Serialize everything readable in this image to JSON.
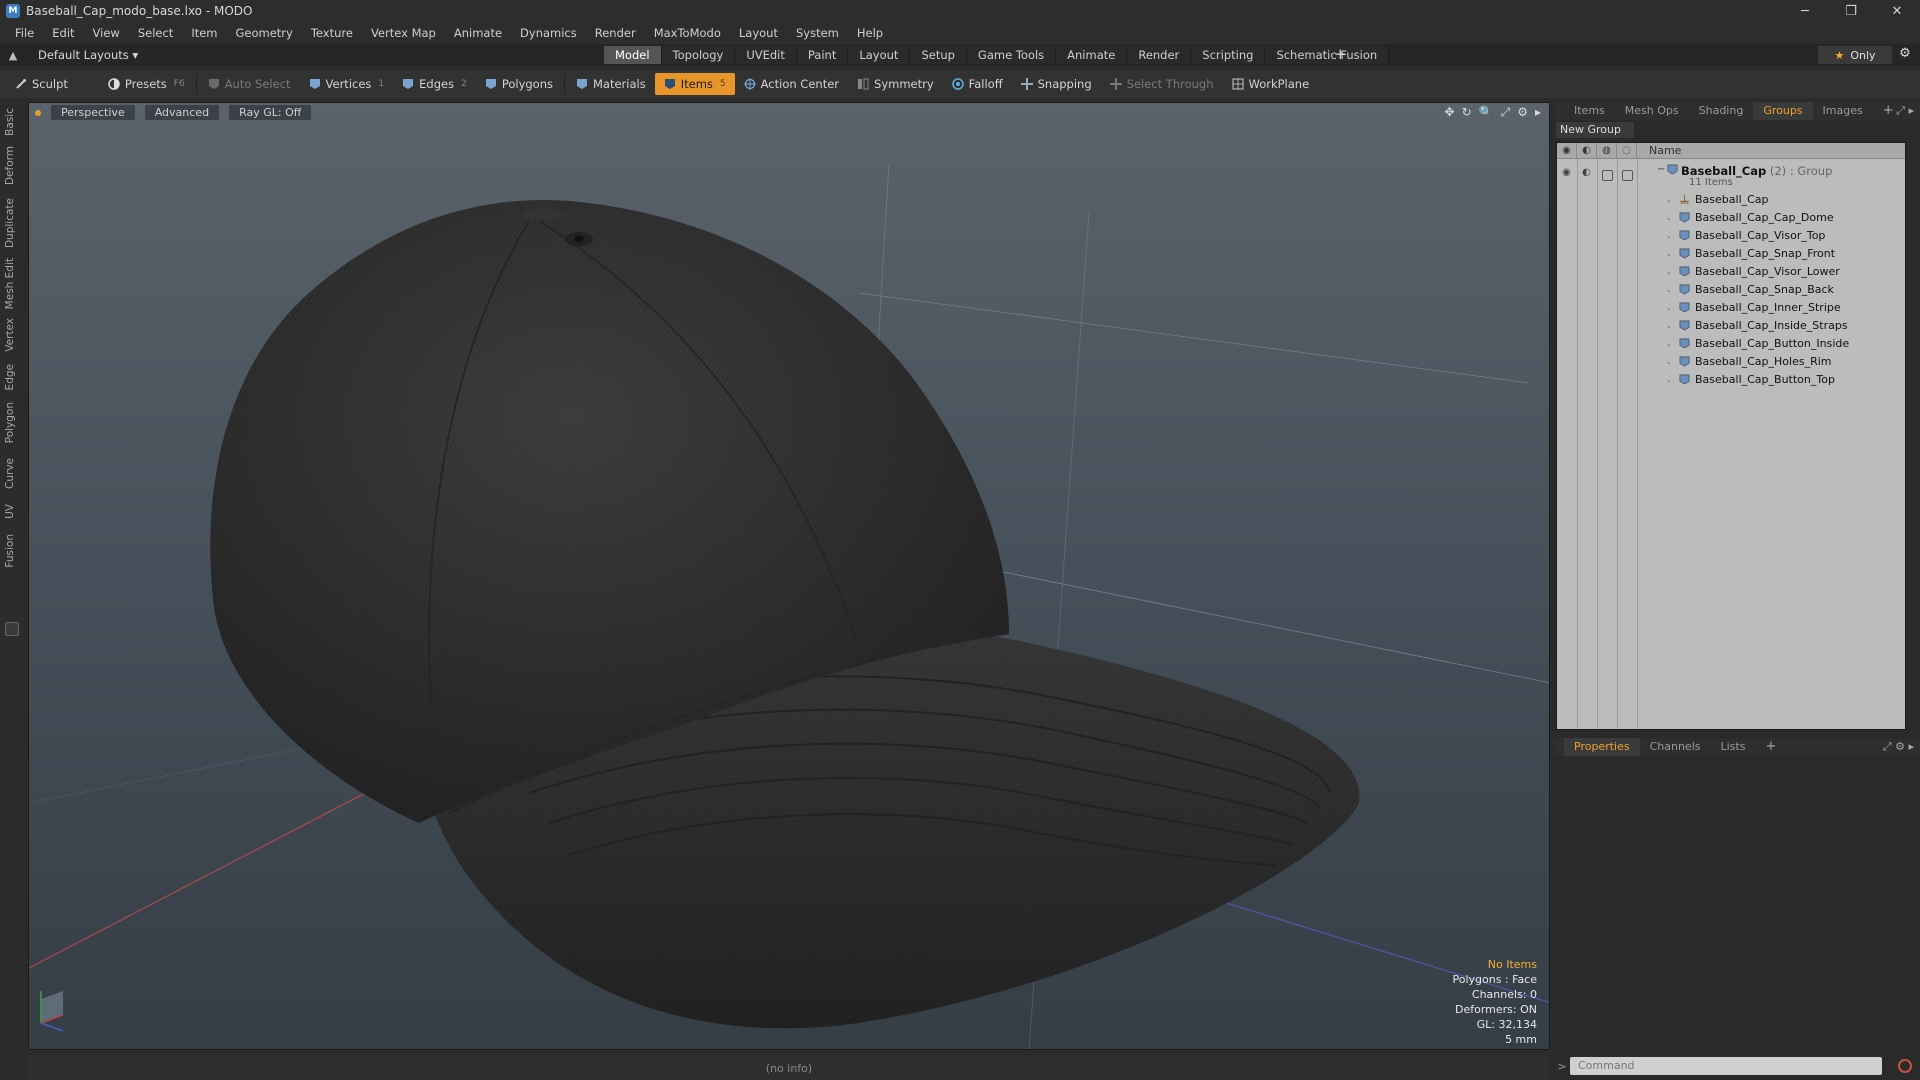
{
  "window": {
    "title": "Baseball_Cap_modo_base.lxo - MODO",
    "icon": "modo-app-icon",
    "controls": [
      "─",
      "❐",
      "✕"
    ]
  },
  "menu": [
    "File",
    "Edit",
    "View",
    "Select",
    "Item",
    "Geometry",
    "Texture",
    "Vertex Map",
    "Animate",
    "Dynamics",
    "Render",
    "MaxToModo",
    "Layout",
    "System",
    "Help"
  ],
  "layoutbar": {
    "layout_select": "Default Layouts ▾",
    "tabs": [
      "Model",
      "Topology",
      "UVEdit",
      "Paint",
      "Layout",
      "Setup",
      "Game Tools",
      "Animate",
      "Render",
      "Scripting",
      "Schematic Fusion"
    ],
    "active_tab": "Model",
    "plus": "+",
    "only_label": "Only",
    "only_star": "★",
    "gear": "⚙"
  },
  "toolbar": {
    "sculpt": "Sculpt",
    "presets": "Presets",
    "presets_hotkey": "F6",
    "auto_select": "Auto Select",
    "vertices": "Vertices",
    "vertices_hotkey": "1",
    "edges": "Edges",
    "edges_hotkey": "2",
    "polygons": "Polygons",
    "materials": "Materials",
    "items": "Items",
    "items_hotkey": "5",
    "action_center": "Action Center",
    "symmetry": "Symmetry",
    "falloff": "Falloff",
    "snapping": "Snapping",
    "select_through": "Select Through",
    "workplane": "WorkPlane",
    "accent": "#e8962a"
  },
  "left_strip": [
    "Basic",
    "Deform",
    "Duplicate",
    "Mesh Edit",
    "Vertex",
    "Edge",
    "Polygon",
    "Curve",
    "UV",
    "Fusion"
  ],
  "viewport": {
    "view": "Perspective",
    "shading": "Advanced",
    "raygl": "Ray GL: Off",
    "tools": [
      "✥",
      "↻",
      "🔍",
      "⤢",
      "⚙",
      "▸"
    ],
    "info": {
      "selection": "No Items",
      "polygons": "Polygons : Face",
      "channels": "Channels: 0",
      "deformers": "Deformers: ON",
      "gl": "GL: 32,134",
      "scale": "5 mm"
    }
  },
  "status": "(no info)",
  "right_panel": {
    "top_tabs": [
      "Items",
      "Mesh Ops",
      "Shading",
      "Groups",
      "Images"
    ],
    "top_active": "Groups",
    "plus": "+",
    "new_group": "New Group",
    "name_col": "Name",
    "group": {
      "name": "Baseball_Cap",
      "suffix": " (2) : Group",
      "count": "11 Items"
    },
    "items": [
      "Baseball_Cap",
      "Baseball_Cap_Cap_Dome",
      "Baseball_Cap_Visor_Top",
      "Baseball_Cap_Snap_Front",
      "Baseball_Cap_Visor_Lower",
      "Baseball_Cap_Snap_Back",
      "Baseball_Cap_Inner_Stripe",
      "Baseball_Cap_Inside_Straps",
      "Baseball_Cap_Button_Inside",
      "Baseball_Cap_Holes_Rim",
      "Baseball_Cap_Button_Top"
    ],
    "bottom_tabs": [
      "Properties",
      "Channels",
      "Lists"
    ],
    "bottom_active": "Properties",
    "command_placeholder": "Command",
    "command_arrow": ">"
  }
}
